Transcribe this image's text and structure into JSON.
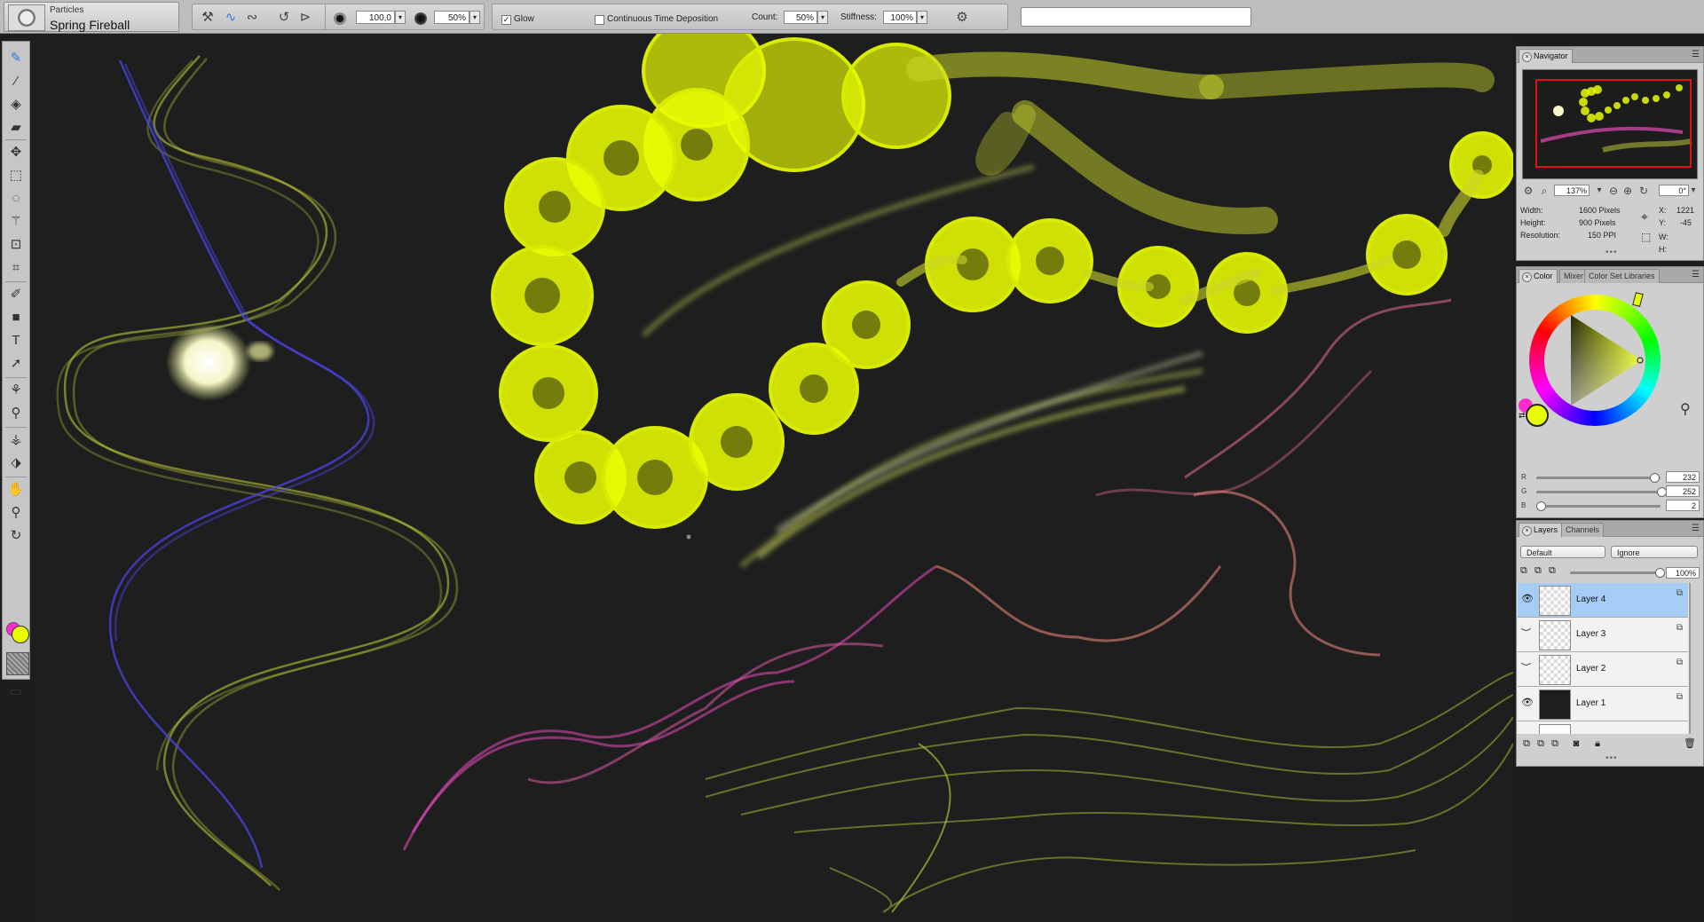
{
  "property_bar": {
    "brush_category": "Particles",
    "brush_name": "Spring Fireball",
    "size_value": "100,0",
    "opacity_value": "50%",
    "glow_label": "Glow",
    "glow_checked": true,
    "continuous_label": "Continuous Time Deposition",
    "continuous_checked": false,
    "count_label": "Count:",
    "count_value": "50%",
    "stiffness_label": "Stiffness:",
    "stiffness_value": "100%",
    "search_value": ""
  },
  "toolbox": {
    "tools": [
      "brush-tool",
      "dropper-tool",
      "paint-bucket-tool",
      "eraser-tool",
      "transform-tool",
      "rectangle-select-tool",
      "lasso-tool",
      "magic-wand-tool",
      "crop-tool",
      "shape-tool",
      "layer-adjuster-tool",
      "pen-tool",
      "rectangle-tool",
      "text-tool",
      "selection-adjuster-tool",
      "perspective-guide-tool",
      "cloner-tool",
      "rubber-stamp-tool",
      "dodge-tool",
      "burn-tool",
      "grabber-tool",
      "magnifier-tool",
      "rotate-page-tool"
    ],
    "main_color": "#e8fc02",
    "additional_color": "#ff2bd0",
    "screen_mode_icon": "screen-mode-icon"
  },
  "navigator": {
    "tab": "Navigator",
    "zoom": "137%",
    "rotation": "0°",
    "width_label": "Width:",
    "width_value": "1600 Pixels",
    "height_label": "Height:",
    "height_value": "900 Pixels",
    "resolution_label": "Resolution:",
    "resolution_value": "150 PPI",
    "x_label": "X:",
    "x_value": "1221",
    "y_label": "Y:",
    "y_value": "-45",
    "w_label": "W:",
    "h_label": "H:"
  },
  "color_panel": {
    "tabs": [
      "Color",
      "Mixer",
      "Color Set Libraries"
    ],
    "r_label": "R",
    "g_label": "G",
    "b_label": "B",
    "r_value": "232",
    "g_value": "252",
    "b_value": "2",
    "main_color": "#e8fc02",
    "additional_color": "#ff2bd0"
  },
  "layers_panel": {
    "tabs": [
      "Layers",
      "Channels"
    ],
    "composite_method": "Default",
    "composite_depth": "Ignore",
    "opacity_value": "100%",
    "layers": [
      {
        "name": "Layer 4",
        "selected": true,
        "visible": true
      },
      {
        "name": "Layer 3",
        "selected": false,
        "visible": false
      },
      {
        "name": "Layer 2",
        "selected": false,
        "visible": false
      },
      {
        "name": "Layer 1",
        "selected": false,
        "visible": true
      }
    ]
  },
  "colors": {
    "neon_yellow": "#e8fc02",
    "particle_pink": "#e24bb8",
    "particle_blue": "#3f3ad8",
    "canvas_bg": "#1e1e1e",
    "selection_blue": "#a5cdf5",
    "nav_frame_red": "#e41010"
  }
}
